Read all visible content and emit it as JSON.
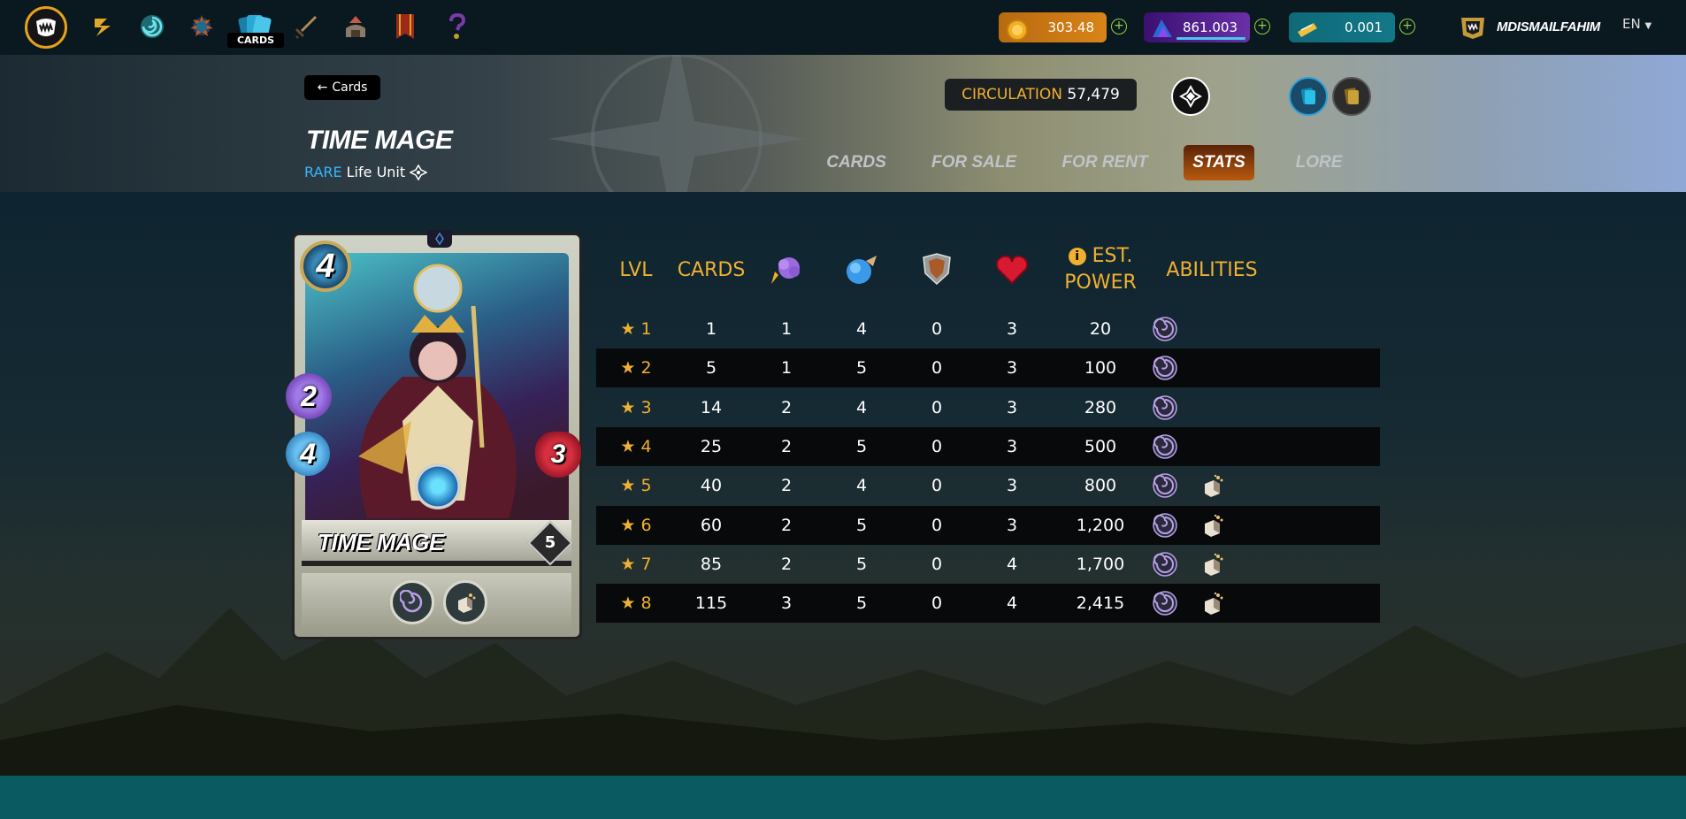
{
  "nav": {
    "items": [
      {
        "icon": "monster-logo-icon"
      },
      {
        "icon": "battle-icon"
      },
      {
        "icon": "portal-icon"
      },
      {
        "icon": "guild-icon"
      },
      {
        "icon": "cards-icon",
        "label": "CARDS"
      },
      {
        "icon": "sword-icon"
      },
      {
        "icon": "land-icon"
      },
      {
        "icon": "banner-icon"
      },
      {
        "icon": "question-icon"
      }
    ],
    "balances": {
      "dec": "303.48",
      "sps": "861.003",
      "voucher": "0.001"
    },
    "username": "MDISMAILFAHIM",
    "language": "EN"
  },
  "header": {
    "back_label": "Cards",
    "card_name": "TIME MAGE",
    "rarity": "RARE",
    "subtitle": "Life Unit",
    "circulation_label": "CIRCULATION",
    "circulation_value": "57,479",
    "tabs": [
      "CARDS",
      "FOR SALE",
      "FOR RENT",
      "STATS",
      "LORE"
    ],
    "active_tab": "STATS"
  },
  "card": {
    "name": "TIME MAGE",
    "mana": "4",
    "magic": "2",
    "speed": "4",
    "health": "3",
    "level": "5",
    "abilities": [
      "slow-icon",
      "dispel-icon"
    ],
    "colors": {
      "accent": "#f0b030",
      "rarity": "#35b6ff"
    }
  },
  "stats_table": {
    "columns": {
      "lvl": "LVL",
      "cards": "CARDS",
      "magic": "magic-attack-icon",
      "speed": "speed-icon",
      "armor": "armor-icon",
      "health": "health-icon",
      "power_line1": "EST.",
      "power_line2": "POWER",
      "abilities": "ABILITIES"
    },
    "rows": [
      {
        "lvl": "★ 1",
        "cards": "1",
        "magic": "1",
        "speed": "4",
        "armor": "0",
        "health": "3",
        "power": "20",
        "abilities": [
          "slow-icon"
        ]
      },
      {
        "lvl": "★ 2",
        "cards": "5",
        "magic": "1",
        "speed": "5",
        "armor": "0",
        "health": "3",
        "power": "100",
        "abilities": [
          "slow-icon"
        ]
      },
      {
        "lvl": "★ 3",
        "cards": "14",
        "magic": "2",
        "speed": "4",
        "armor": "0",
        "health": "3",
        "power": "280",
        "abilities": [
          "slow-icon"
        ]
      },
      {
        "lvl": "★ 4",
        "cards": "25",
        "magic": "2",
        "speed": "5",
        "armor": "0",
        "health": "3",
        "power": "500",
        "abilities": [
          "slow-icon"
        ]
      },
      {
        "lvl": "★ 5",
        "cards": "40",
        "magic": "2",
        "speed": "4",
        "armor": "0",
        "health": "3",
        "power": "800",
        "abilities": [
          "slow-icon",
          "dispel-icon"
        ]
      },
      {
        "lvl": "★ 6",
        "cards": "60",
        "magic": "2",
        "speed": "5",
        "armor": "0",
        "health": "3",
        "power": "1,200",
        "abilities": [
          "slow-icon",
          "dispel-icon"
        ]
      },
      {
        "lvl": "★ 7",
        "cards": "85",
        "magic": "2",
        "speed": "5",
        "armor": "0",
        "health": "4",
        "power": "1,700",
        "abilities": [
          "slow-icon",
          "dispel-icon"
        ]
      },
      {
        "lvl": "★ 8",
        "cards": "115",
        "magic": "3",
        "speed": "5",
        "armor": "0",
        "health": "4",
        "power": "2,415",
        "abilities": [
          "slow-icon",
          "dispel-icon"
        ]
      }
    ]
  }
}
